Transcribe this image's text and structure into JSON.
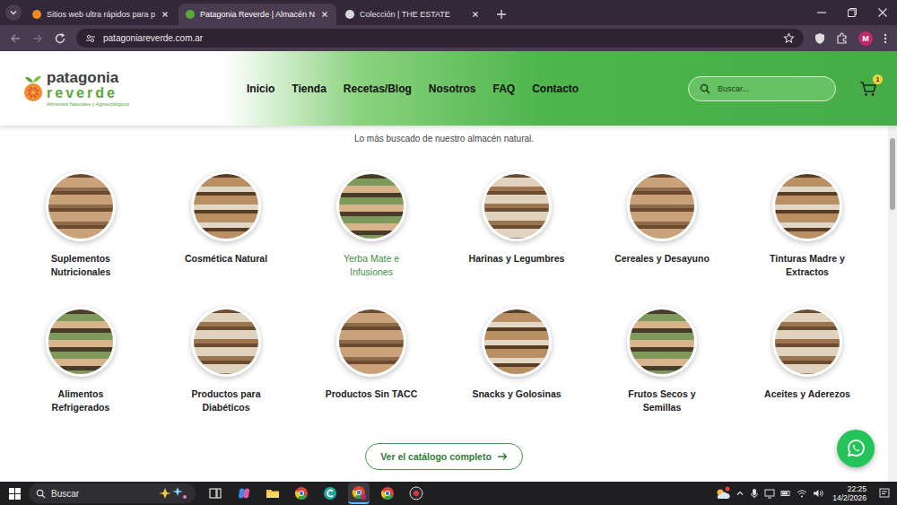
{
  "browser": {
    "tabs": [
      {
        "label": "Sitios web ultra rápidos para p",
        "selected": false
      },
      {
        "label": "Patagonia Reverde | Almacén N",
        "selected": true
      },
      {
        "label": "Colección | THE ESTATE",
        "selected": false
      }
    ],
    "url": "patagoniareverde.com.ar",
    "profile": "M"
  },
  "site": {
    "logo": {
      "line1": "patagonia",
      "line2": "reverde",
      "tagline": "Alimentos Naturales y Agroecológicos"
    },
    "nav": [
      {
        "label": "Inicio",
        "selected": false
      },
      {
        "label": "Tienda",
        "selected": false
      },
      {
        "label": "Recetas/Blog",
        "selected": false
      },
      {
        "label": "Nosotros",
        "selected": false
      },
      {
        "label": "FAQ",
        "selected": false
      },
      {
        "label": "Contacto",
        "selected": false
      }
    ],
    "search": {
      "placeholder": "Buscar..."
    },
    "cart": {
      "count": "1"
    },
    "subtitle": "Lo más buscado de nuestro almacén natural.",
    "categories": [
      {
        "label": "Suplementos Nutricionales",
        "hovered": false
      },
      {
        "label": "Cosmética Natural",
        "hovered": false
      },
      {
        "label": "Yerba Mate e Infusiones",
        "hovered": true
      },
      {
        "label": "Harinas y Legumbres",
        "hovered": false
      },
      {
        "label": "Cereales y Desayuno",
        "hovered": false
      },
      {
        "label": "Tinturas Madre y Extractos",
        "hovered": false
      },
      {
        "label": "Alimentos Refrigerados",
        "hovered": false
      },
      {
        "label": "Productos para Diabéticos",
        "hovered": false
      },
      {
        "label": "Productos Sin TACC",
        "hovered": false
      },
      {
        "label": "Snacks y Golosinas",
        "hovered": false
      },
      {
        "label": "Frutos Secos y Semillas",
        "hovered": false
      },
      {
        "label": "Aceites y Aderezos",
        "hovered": false
      }
    ],
    "cta": "Ver el catálogo completo"
  },
  "taskbar": {
    "search": "Buscar",
    "time": "22:25",
    "date": "14/2/2026"
  }
}
